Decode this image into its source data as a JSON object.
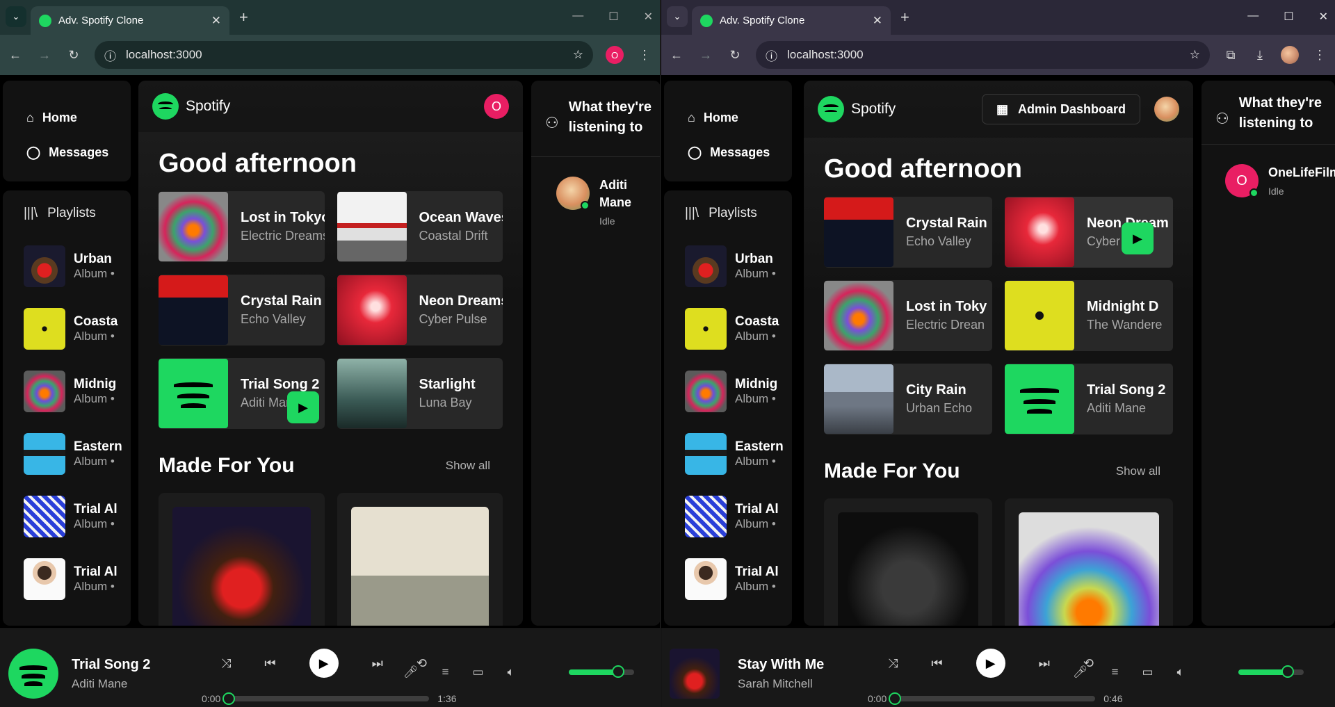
{
  "left": {
    "tab_title": "Adv. Spotify Clone",
    "url": "localhost:3000",
    "profile_letter": "O",
    "nav": [
      {
        "label": "Home"
      },
      {
        "label": "Messages"
      }
    ],
    "playlists_header": "Playlists",
    "playlists": [
      {
        "name": "Urban",
        "sub": "Album •"
      },
      {
        "name": "Coasta",
        "sub": "Album •"
      },
      {
        "name": "Midnig",
        "sub": "Album •"
      },
      {
        "name": "Eastern",
        "sub": "Album •"
      },
      {
        "name": "Trial Al",
        "sub": "Album •"
      },
      {
        "name": "Trial Al",
        "sub": "Album •"
      }
    ],
    "brand": "Spotify",
    "avatar_letter": "O",
    "greeting": "Good afternoon",
    "featured": [
      {
        "title": "Lost in Tokyo",
        "artist": "Electric Dreams"
      },
      {
        "title": "Ocean Waves",
        "artist": "Coastal Drift"
      },
      {
        "title": "Crystal Rain",
        "artist": "Echo Valley"
      },
      {
        "title": "Neon Dreams",
        "artist": "Cyber Pulse"
      },
      {
        "title": "Trial Song 2",
        "artist": "Aditi Mane"
      },
      {
        "title": "Starlight",
        "artist": "Luna Bay"
      }
    ],
    "section_title": "Made For You",
    "show_all": "Show all",
    "friends_title": "What they're listening to",
    "friend": {
      "name": "Aditi Mane",
      "status": "Idle"
    },
    "player": {
      "title": "Trial Song 2",
      "artist": "Aditi Mane",
      "current": "0:00",
      "duration": "1:36",
      "progress": 0.0,
      "volume": 0.75
    }
  },
  "right": {
    "tab_title": "Adv. Spotify Clone",
    "url": "localhost:3000",
    "nav": [
      {
        "label": "Home"
      },
      {
        "label": "Messages"
      }
    ],
    "playlists_header": "Playlists",
    "playlists": [
      {
        "name": "Urban",
        "sub": "Album •"
      },
      {
        "name": "Coasta",
        "sub": "Album •"
      },
      {
        "name": "Midnig",
        "sub": "Album •"
      },
      {
        "name": "Eastern",
        "sub": "Album •"
      },
      {
        "name": "Trial Al",
        "sub": "Album •"
      },
      {
        "name": "Trial Al",
        "sub": "Album •"
      }
    ],
    "brand": "Spotify",
    "admin_label": "Admin Dashboard",
    "greeting": "Good afternoon",
    "featured": [
      {
        "title": "Crystal Rain",
        "artist": "Echo Valley"
      },
      {
        "title": "Neon Dream",
        "artist": "Cyber"
      },
      {
        "title": "Lost in Toky",
        "artist": "Electric Drean"
      },
      {
        "title": "Midnight D",
        "artist": "The Wandere"
      },
      {
        "title": "City Rain",
        "artist": "Urban Echo"
      },
      {
        "title": "Trial Song 2",
        "artist": "Aditi Mane"
      }
    ],
    "section_title": "Made For You",
    "show_all": "Show all",
    "friends_title": "What they're listening to",
    "friend": {
      "name": "OneLifeFilm",
      "status": "Idle",
      "letter": "O"
    },
    "player": {
      "title": "Stay With Me",
      "artist": "Sarah Mitchell",
      "current": "0:00",
      "duration": "0:46",
      "progress": 0.0,
      "volume": 0.75
    }
  },
  "colors": {
    "accent": "#1ed760",
    "avatar_pink": "#e91e63",
    "bg": "#121212"
  }
}
